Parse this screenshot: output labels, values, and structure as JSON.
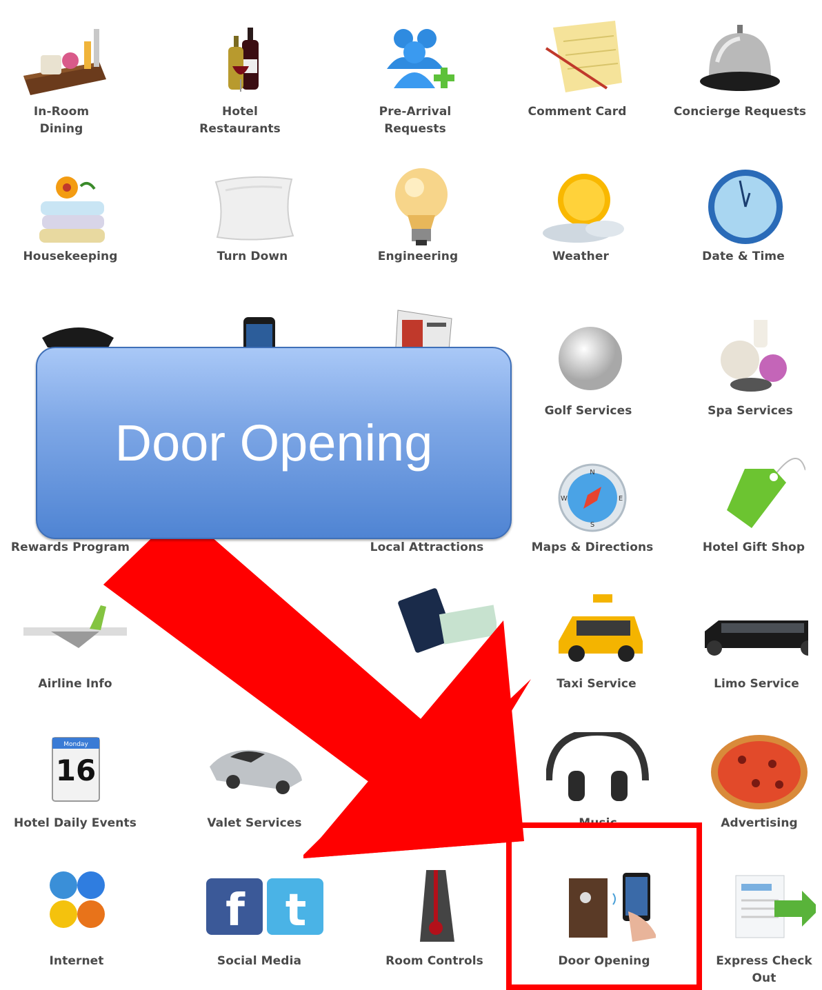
{
  "tiles": [
    {
      "label": "In-Room\nDining",
      "icon": "dining-tray-icon"
    },
    {
      "label": "Hotel\nRestaurants",
      "icon": "wine-bottles-icon"
    },
    {
      "label": "Pre-Arrival\nRequests",
      "icon": "people-add-icon"
    },
    {
      "label": "Comment Card",
      "icon": "notepad-pencil-icon"
    },
    {
      "label": "Concierge Requests",
      "icon": "service-bell-icon"
    },
    {
      "label": "Housekeeping",
      "icon": "towels-flower-icon"
    },
    {
      "label": "Turn Down",
      "icon": "pillow-icon"
    },
    {
      "label": "Engineering",
      "icon": "light-bulb-icon"
    },
    {
      "label": "Weather",
      "icon": "sun-cloud-icon"
    },
    {
      "label": "Date & Time",
      "icon": "clock-icon"
    },
    {
      "label": "Golf Services",
      "icon": "golf-ball-icon"
    },
    {
      "label": "Spa Services",
      "icon": "spa-bottles-icon"
    },
    {
      "label": "Rewards Program",
      "icon": "rewards-card-icon"
    },
    {
      "label": "Local Attractions",
      "icon": "brochures-icon"
    },
    {
      "label": "Maps & Directions",
      "icon": "compass-icon"
    },
    {
      "label": "Hotel Gift Shop",
      "icon": "price-tag-icon"
    },
    {
      "label": "Airline Info",
      "icon": "airplane-icon"
    },
    {
      "label": "Taxi Service",
      "icon": "taxi-icon"
    },
    {
      "label": "Limo Service",
      "icon": "limousine-icon"
    },
    {
      "label": "Hotel Daily Events",
      "icon": "calendar-icon"
    },
    {
      "label": "Valet Services",
      "icon": "sports-car-icon"
    },
    {
      "label": "Music",
      "icon": "headphones-icon"
    },
    {
      "label": "Advertising",
      "icon": "pizza-icon"
    },
    {
      "label": "Internet",
      "icon": "browsers-icon"
    },
    {
      "label": "Social Media",
      "icon": "social-icons-icon"
    },
    {
      "label": "Room Controls",
      "icon": "thermometer-icon"
    },
    {
      "label": "Door Opening",
      "icon": "door-phone-icon"
    },
    {
      "label": "Express Check\nOut",
      "icon": "document-arrow-icon"
    }
  ],
  "calendar": {
    "day": "Monday",
    "date": "16"
  },
  "compass": {
    "n": "N",
    "e": "E",
    "s": "S",
    "w": "W"
  },
  "callout": {
    "text": "Door Opening"
  },
  "colors": {
    "arrow": "#ff0000",
    "callout": "#5b8ee0",
    "highlight": "#ff0000",
    "label": "#4a4a4a"
  }
}
